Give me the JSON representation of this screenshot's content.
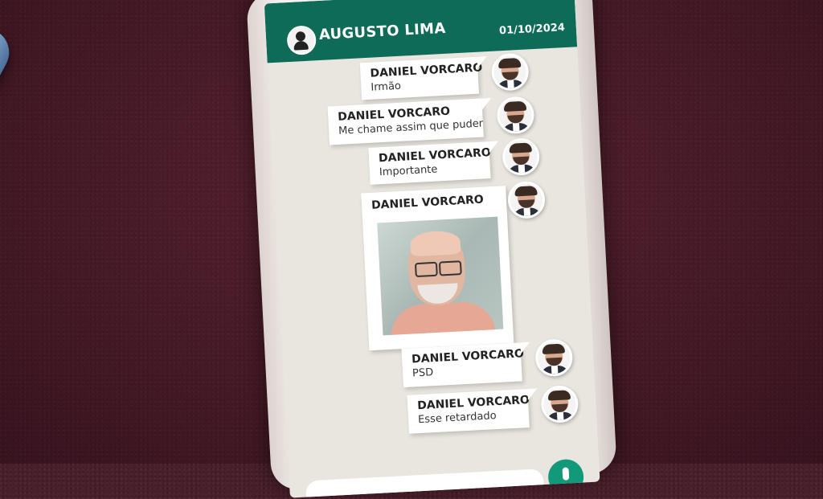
{
  "chat": {
    "contact_name": "AUGUSTO LIMA",
    "date": "01/10/2024"
  },
  "messages": [
    {
      "sender": "DANIEL VORCARO",
      "text": "Irmão"
    },
    {
      "sender": "DANIEL VORCARO",
      "text": "Me chame assim que puder"
    },
    {
      "sender": "DANIEL VORCARO",
      "text": "Importante"
    },
    {
      "sender": "DANIEL VORCARO",
      "text": ""
    },
    {
      "sender": "DANIEL VORCARO",
      "text": "PSD"
    },
    {
      "sender": "DANIEL VORCARO",
      "text": "Esse retardado"
    }
  ],
  "colors": {
    "header": "#0d6b58",
    "background": "#4a1f2c",
    "mic": "#11997a"
  },
  "icons": [
    "contact-avatar-icon",
    "sender-avatar-icon",
    "mic-icon"
  ]
}
